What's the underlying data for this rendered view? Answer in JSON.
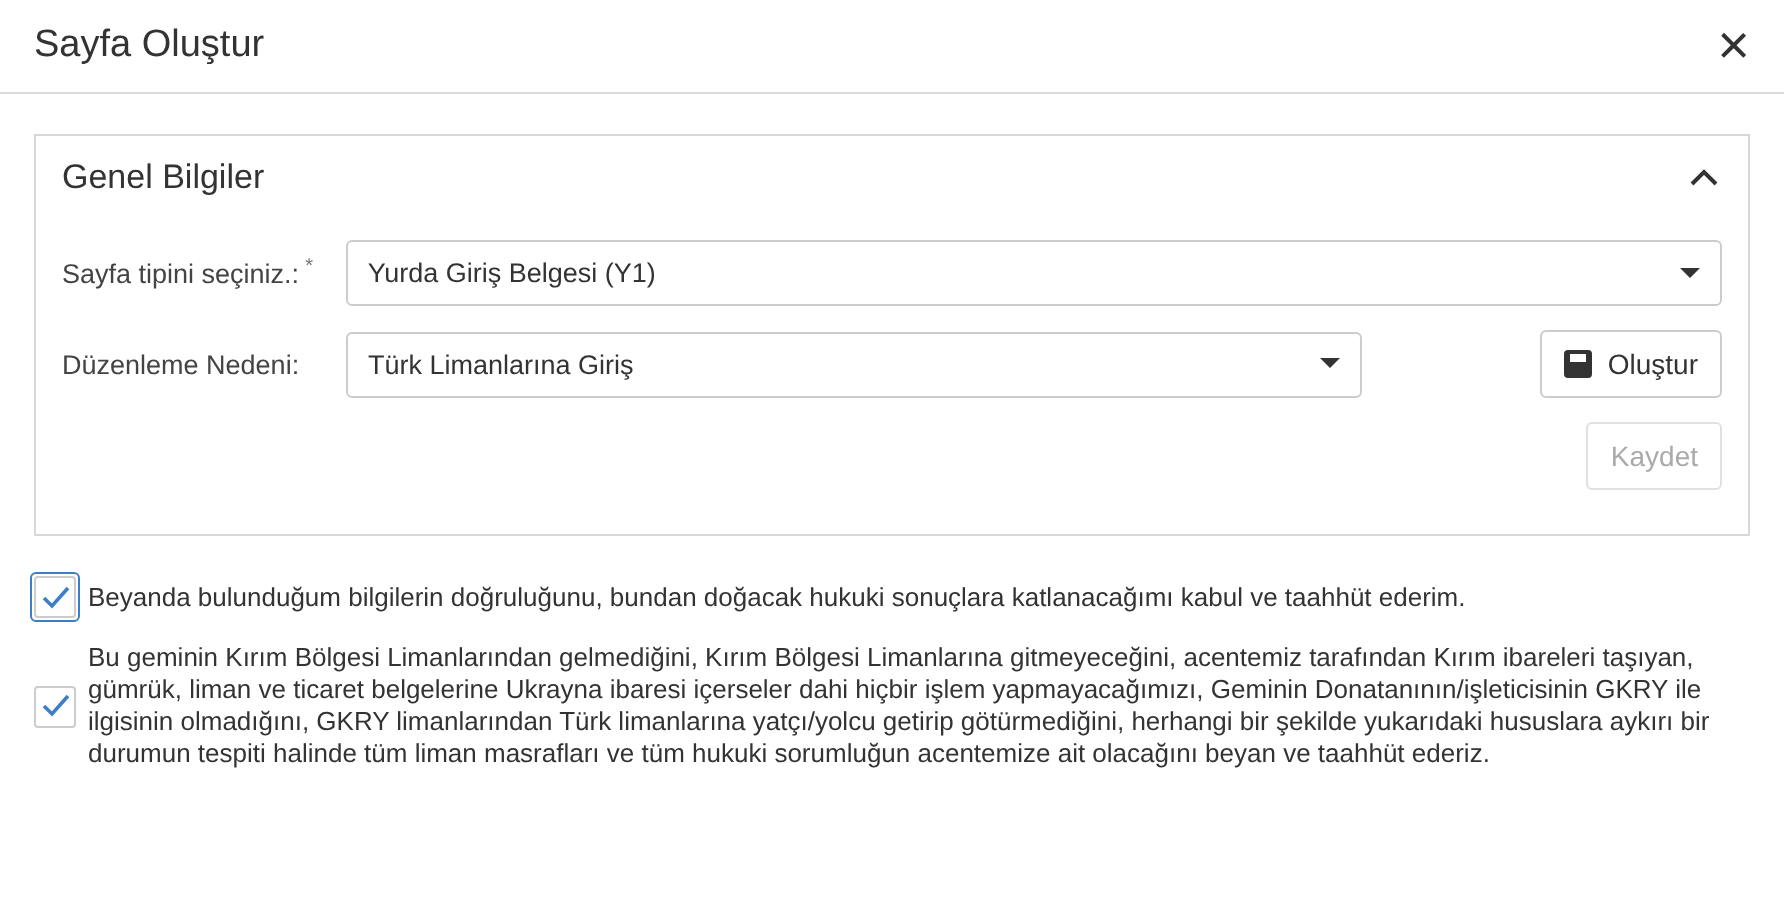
{
  "dialog": {
    "title": "Sayfa Oluştur",
    "close": "×"
  },
  "panel": {
    "title": "Genel Bilgiler",
    "expanded": true,
    "fields": [
      {
        "label": "Sayfa tipini seçiniz.:",
        "required": true,
        "required_mark": "*",
        "value": "Yurda Giriş Belgesi (Y1)",
        "wide": true
      },
      {
        "label": "Düzenleme Nedeni:",
        "required": false,
        "value": "Türk Limanlarına Giriş",
        "wide": false
      }
    ],
    "create_button": {
      "label": "Oluştur"
    },
    "save_button": {
      "label": "Kaydet",
      "disabled": true
    }
  },
  "agreements": [
    {
      "text": "Beyanda bulunduğum bilgilerin doğruluğunu, bundan doğacak hukuki sonuçlara katlanacağımı kabul ve taahhüt ederim.",
      "checked": true,
      "focused": true
    },
    {
      "text": "Bu geminin Kırım Bölgesi Limanlarından gelmediğini, Kırım Bölgesi Limanlarına gitmeyeceğini, acentemiz tarafından Kırım ibareleri taşıyan, gümrük, liman ve ticaret belgelerine Ukrayna ibaresi içerseler dahi hiçbir işlem yapmayacağımızı, Geminin Donatanının/işleticisinin GKRY ile ilgisinin olmadığını, GKRY limanlarından Türk limanlarına yatçı/yolcu getirip götürmediğini, herhangi bir şekilde yukarıdaki hususlara aykırı bir durumun tespiti halinde tüm liman masrafları ve tüm hukuki sorumluğun acentemize ait olacağını beyan ve taahhüt ederiz.",
      "checked": true,
      "focused": false
    }
  ]
}
